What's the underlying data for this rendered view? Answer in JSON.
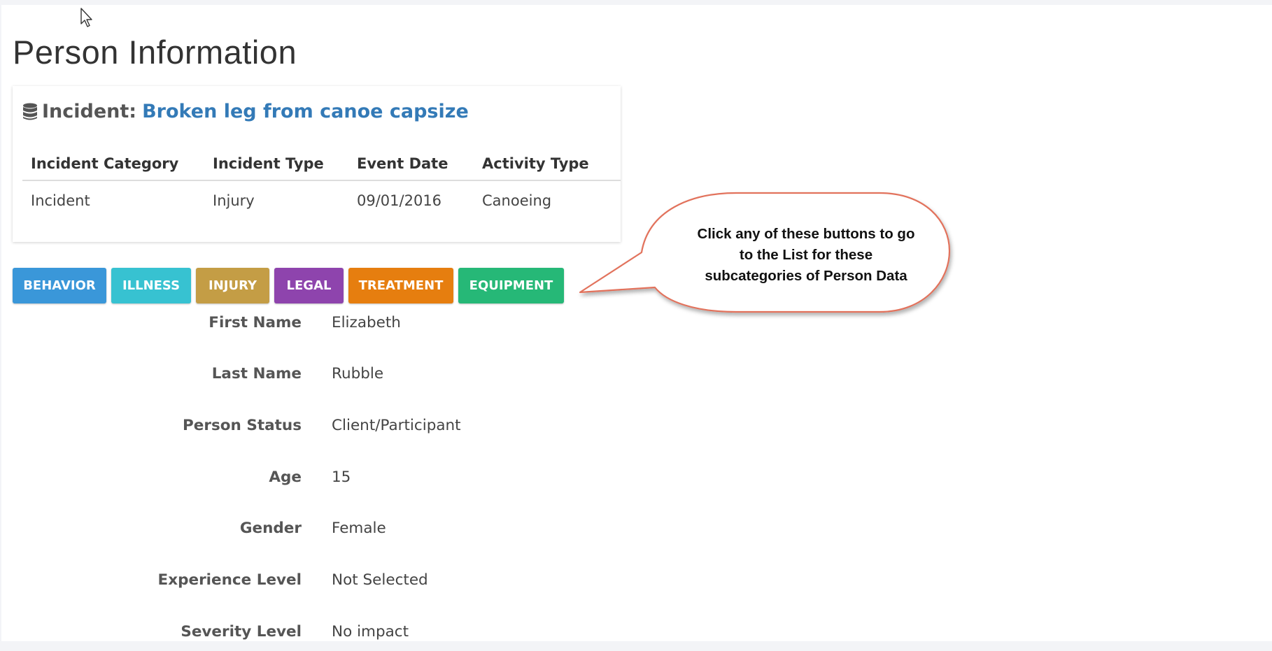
{
  "page": {
    "title": "Person Information"
  },
  "incident": {
    "prefix": "Incident:",
    "name": "Broken leg from canoe capsize",
    "icon": "database-icon",
    "table": {
      "headers": [
        "Incident Category",
        "Incident Type",
        "Event Date",
        "Activity Type"
      ],
      "rows": [
        [
          "Incident",
          "Injury",
          "09/01/2016",
          "Canoeing"
        ]
      ]
    }
  },
  "buttons": [
    {
      "label": "BEHAVIOR",
      "color": "#3a97d9"
    },
    {
      "label": "ILLNESS",
      "color": "#37c2d1"
    },
    {
      "label": "INJURY",
      "color": "#c49d45"
    },
    {
      "label": "LEGAL",
      "color": "#8e44ad"
    },
    {
      "label": "TREATMENT",
      "color": "#e67e0f"
    },
    {
      "label": "EQUIPMENT",
      "color": "#26b877"
    }
  ],
  "callout": {
    "text": "Click any of these buttons to go to the List for these subcategories of Person Data",
    "border_color": "#e2725b"
  },
  "person": [
    {
      "label": "First Name",
      "value": "Elizabeth"
    },
    {
      "label": "Last Name",
      "value": "Rubble"
    },
    {
      "label": "Person Status",
      "value": "Client/Participant"
    },
    {
      "label": "Age",
      "value": "15"
    },
    {
      "label": "Gender",
      "value": "Female"
    },
    {
      "label": "Experience Level",
      "value": "Not Selected"
    },
    {
      "label": "Severity Level",
      "value": "No impact"
    }
  ],
  "colors": {
    "link": "#337ab7",
    "label_text": "#555555"
  }
}
